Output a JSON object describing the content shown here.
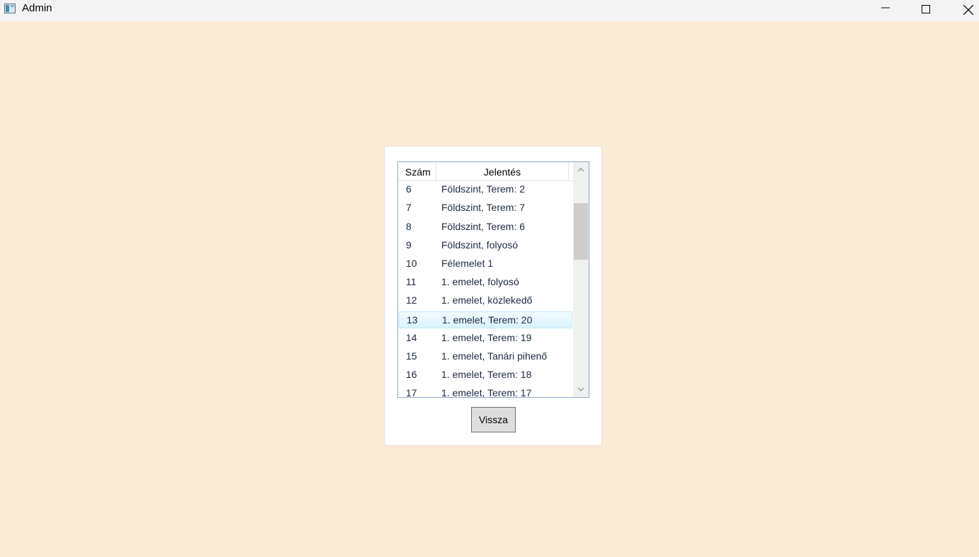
{
  "window": {
    "title": "Admin",
    "icon": "app-window-icon",
    "controls": [
      "minimize-icon",
      "maximize-icon",
      "close-icon"
    ]
  },
  "listview": {
    "columns": [
      "Szám",
      "Jelentés"
    ],
    "rows": [
      {
        "num": "6",
        "text": "Földszint, Terem: 2"
      },
      {
        "num": "7",
        "text": "Földszint, Terem: 7"
      },
      {
        "num": "8",
        "text": "Földszint, Terem: 6"
      },
      {
        "num": "9",
        "text": "Földszint, folyosó"
      },
      {
        "num": "10",
        "text": "Félemelet 1"
      },
      {
        "num": "11",
        "text": "1. emelet, folyosó"
      },
      {
        "num": "12",
        "text": "1. emelet, közlekedő"
      },
      {
        "num": "13",
        "text": "1. emelet, Terem: 20"
      },
      {
        "num": "14",
        "text": "1. emelet, Terem: 19"
      },
      {
        "num": "15",
        "text": "1. emelet, Tanári pihenő"
      },
      {
        "num": "16",
        "text": "1. emelet, Terem: 18"
      },
      {
        "num": "17",
        "text": "1. emelet, Terem: 17"
      }
    ],
    "hovered_row": "13"
  },
  "buttons": {
    "back_label": "Vissza"
  },
  "colors": {
    "background": "#faebd7",
    "hover": "#daf2fd",
    "text": "#1b2a44"
  }
}
